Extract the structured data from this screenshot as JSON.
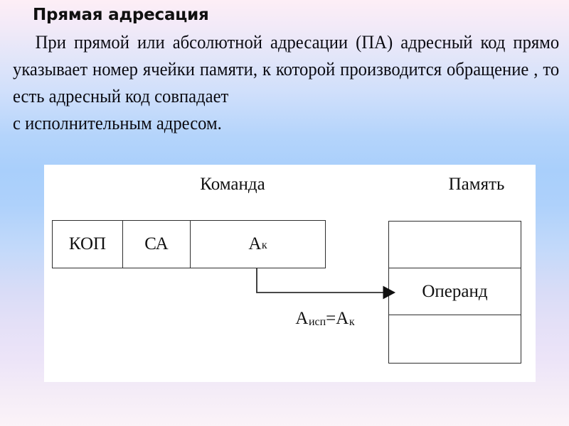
{
  "slide": {
    "title": "Прямая адресация",
    "paragraph_lines": [
      "При прямой или абсолютной адресации (ПА) адресный",
      "код прямо указывает номер ячейки памяти, к которой",
      "производится обращение , то есть адресный код совпадает",
      "с исполнительным адресом."
    ]
  },
  "diagram": {
    "headings": {
      "command": "Команда",
      "memory": "Память"
    },
    "command_fields": [
      {
        "label": "КОП"
      },
      {
        "label": "СА"
      },
      {
        "label": "А",
        "sub": "к"
      }
    ],
    "memory_cells": [
      {
        "label": ""
      },
      {
        "label": "Операнд"
      },
      {
        "label": ""
      }
    ],
    "arrow": {
      "label_main_1": "А",
      "label_sub_1": "исп",
      "label_equals": "=",
      "label_main_2": "А",
      "label_sub_2": "к"
    }
  },
  "colors": {
    "panel_background": "#ffffff",
    "stroke": "#2e2e2e",
    "text": "#111111",
    "gradient_top": "#fdeef6",
    "gradient_mid": "#a9cffb",
    "gradient_bottom": "#fbf3f8"
  }
}
